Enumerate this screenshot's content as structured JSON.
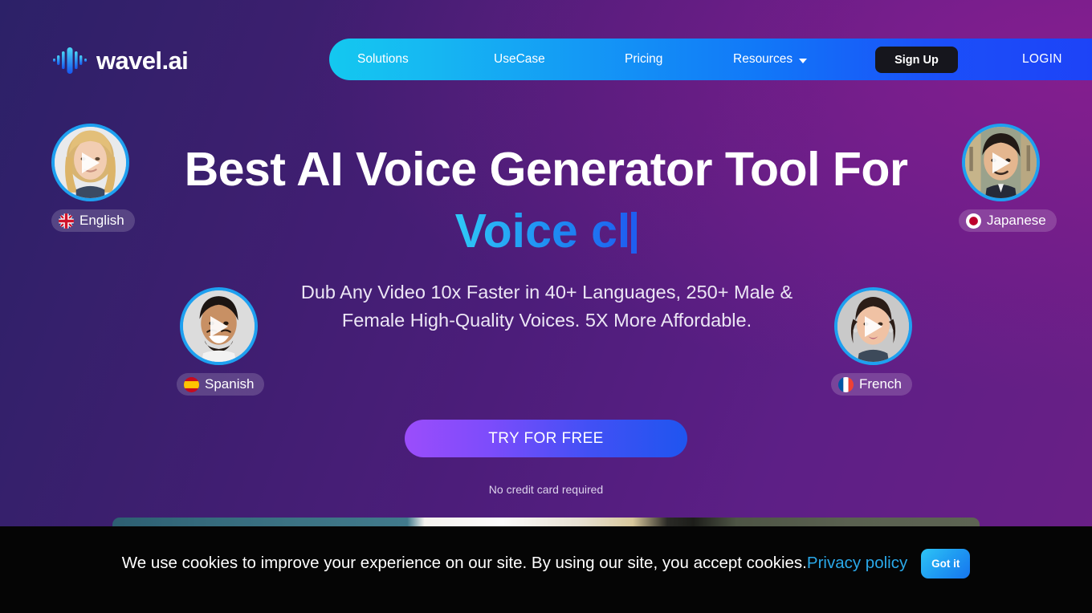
{
  "brand": {
    "name": "wavel.ai",
    "logo_icon": "waveform-icon"
  },
  "nav": {
    "items": [
      {
        "label": "Solutions",
        "icon": null
      },
      {
        "label": "UseCase",
        "icon": null
      },
      {
        "label": "Pricing",
        "icon": null
      },
      {
        "label": "Resources",
        "icon": "chevron-down-icon"
      }
    ],
    "signup_label": "Sign Up",
    "login_label": "LOGIN",
    "gradient_from": "#14c8f0",
    "gradient_to": "#1d43f7"
  },
  "hero": {
    "title": "Best AI Voice Generator Tool For",
    "typed_text": "Voice cl",
    "typed_gradient_from": "#2fc9f7",
    "typed_gradient_to": "#1f5ef0",
    "subtitle": "Dub Any Video 10x Faster in 40+ Languages, 250+ Male & Female High-Quality Voices. 5X More Affordable.",
    "cta_label": "TRY FOR FREE",
    "cta_note": "No credit card required"
  },
  "avatars": [
    {
      "language": "English",
      "flag": "flag-uk",
      "play_icon": "play-icon",
      "position": "top-left"
    },
    {
      "language": "Japanese",
      "flag": "flag-japan",
      "play_icon": "play-icon",
      "position": "top-right"
    },
    {
      "language": "Spanish",
      "flag": "flag-spain",
      "play_icon": "play-icon",
      "position": "mid-left"
    },
    {
      "language": "French",
      "flag": "flag-france",
      "play_icon": "play-icon",
      "position": "mid-right"
    }
  ],
  "cookie": {
    "message": "We use cookies to improve your experience on our site. By using our site, you accept cookies.",
    "link_label": "Privacy policy",
    "accept_label": "Got it",
    "link_color": "#2aa8e8"
  }
}
